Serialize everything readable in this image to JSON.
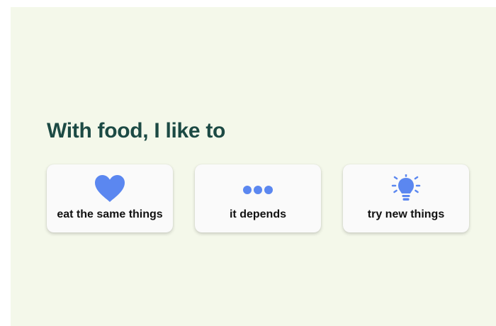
{
  "question": {
    "text": "With food, I like to"
  },
  "options": [
    {
      "label": "eat the same things",
      "icon": "heart-icon"
    },
    {
      "label": "it depends",
      "icon": "dots-icon"
    },
    {
      "label": "try new things",
      "icon": "lightbulb-icon"
    }
  ],
  "colors": {
    "background": "#f4f8ea",
    "heading": "#1c4a44",
    "icon_accent": "#5b87f0",
    "card": "#fafafa",
    "label": "#111111"
  }
}
